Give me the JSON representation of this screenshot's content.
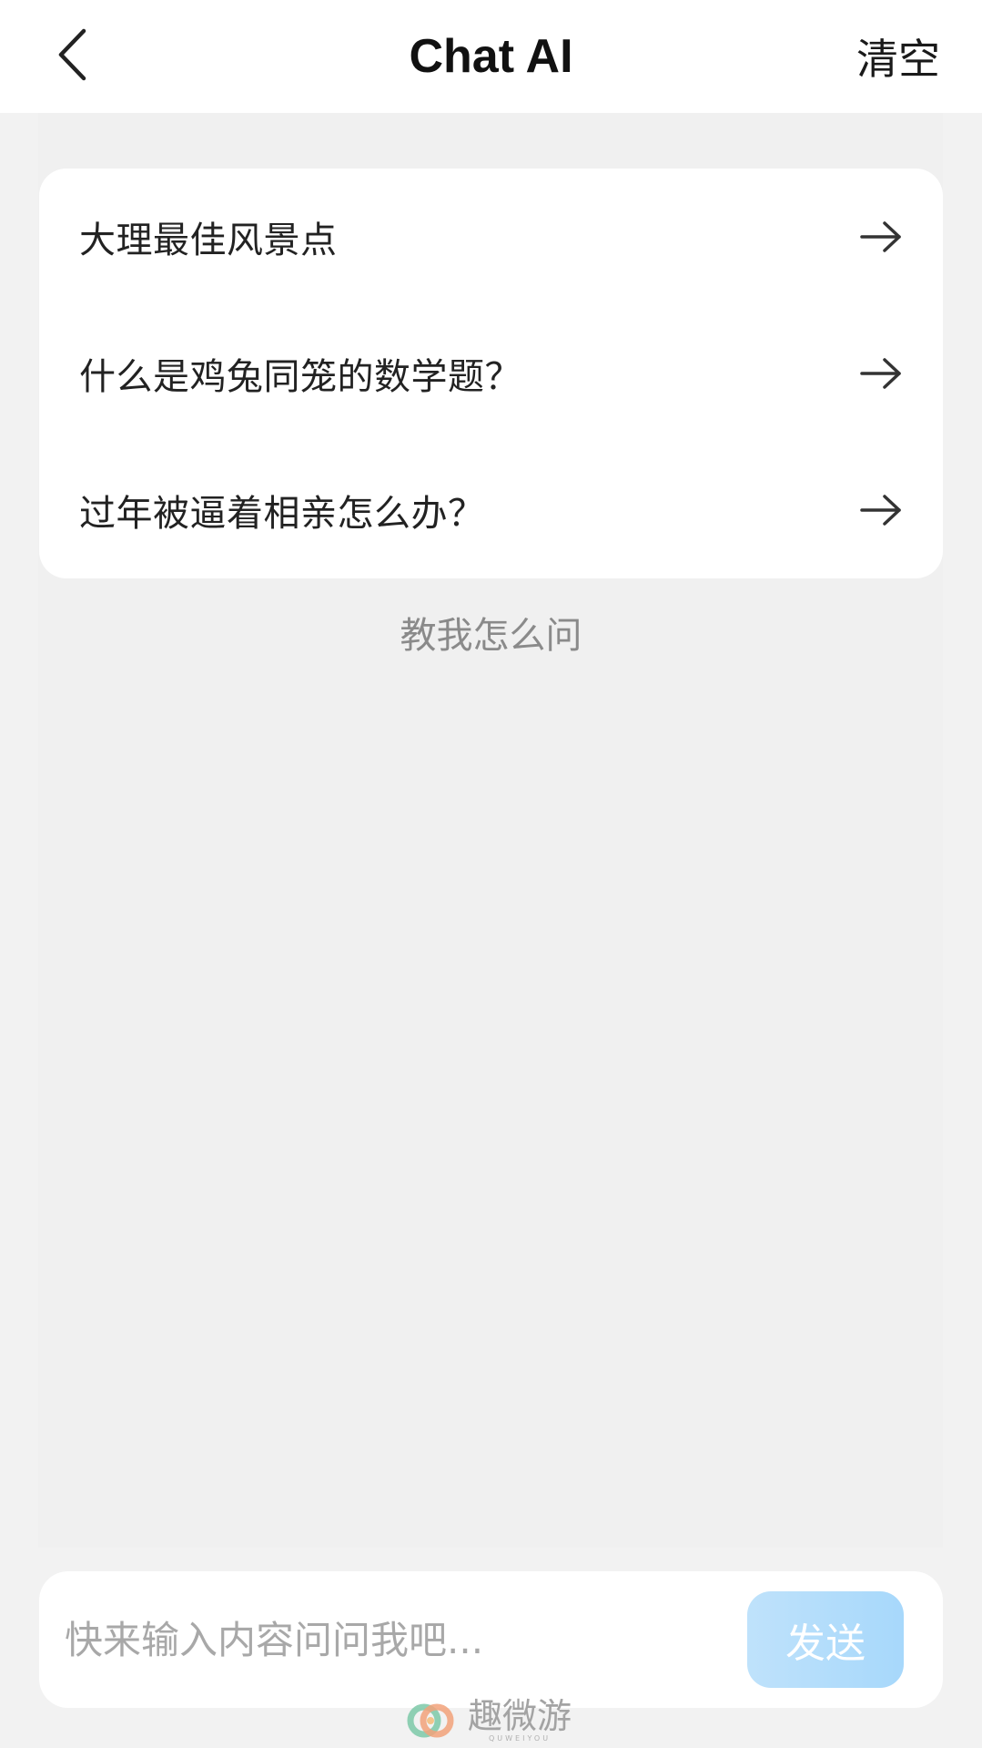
{
  "header": {
    "title": "Chat AI",
    "clear_label": "清空",
    "back_icon": "chevron-left-icon"
  },
  "suggestions": [
    {
      "text": "大理最佳风景点",
      "icon": "arrow-right-icon"
    },
    {
      "text": "什么是鸡兔同笼的数学题？",
      "icon": "arrow-right-icon"
    },
    {
      "text": "过年被逼着相亲怎么办？",
      "icon": "arrow-right-icon"
    }
  ],
  "teach_link": "教我怎么问",
  "composer": {
    "placeholder": "快来输入内容问问我吧...",
    "value": "",
    "send_label": "发送"
  },
  "watermark": {
    "main": "趣微游",
    "sub": "QUWEIYOU"
  },
  "colors": {
    "background": "#f2f2f2",
    "card": "#ffffff",
    "send_button": "#a7d8fb",
    "muted_text": "#8a8a8a"
  }
}
